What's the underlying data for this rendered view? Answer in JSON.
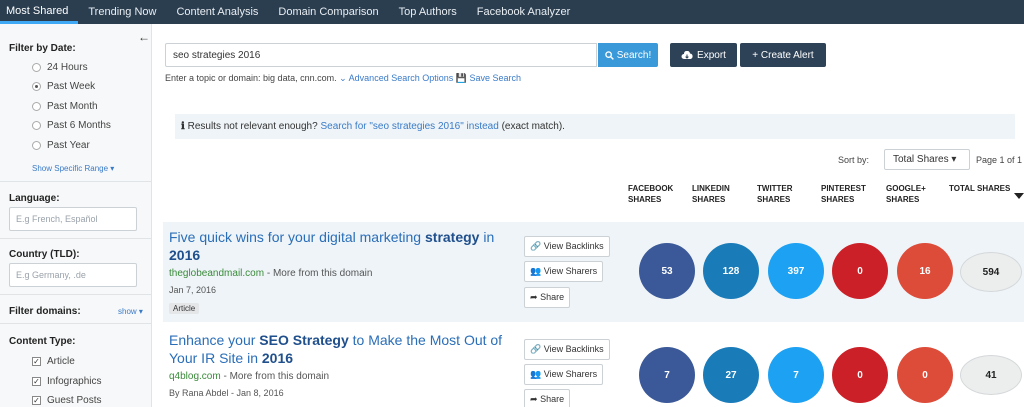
{
  "nav": {
    "tabs": [
      "Most Shared",
      "Trending Now",
      "Content Analysis",
      "Domain Comparison",
      "Top Authors",
      "Facebook Analyzer"
    ]
  },
  "sidebar": {
    "collapse_icon": "arrow-left-icon",
    "filter_date_title": "Filter by Date:",
    "date_options": [
      "24 Hours",
      "Past Week",
      "Past Month",
      "Past 6 Months",
      "Past Year"
    ],
    "date_selected": "Past Week",
    "show_specific_range": "Show Specific Range",
    "language_title": "Language:",
    "language_placeholder": "E.g French, Español",
    "country_title": "Country (TLD):",
    "country_placeholder": "E.g Germany, .de",
    "filter_domains_title": "Filter domains:",
    "filter_domains_show": "show",
    "content_type_title": "Content Type:",
    "content_types": [
      "Article",
      "Infographics",
      "Guest Posts"
    ]
  },
  "search": {
    "value": "seo strategies 2016",
    "button": "Search!",
    "export": "Export",
    "create_alert": "+ Create Alert",
    "hint": "Enter a topic or domain: big data, cnn.com.",
    "advanced": "Advanced Search Options",
    "save": "Save Search"
  },
  "notice": {
    "prefix": "Results not relevant enough?",
    "link": "Search for \"seo strategies 2016\" instead",
    "suffix": "(exact match)."
  },
  "sort": {
    "label": "Sort by:",
    "selected": "Total Shares",
    "page": "Page 1 of 1"
  },
  "columns": [
    {
      "line1": "FACEBOOK",
      "line2": "SHARES"
    },
    {
      "line1": "LINKEDIN",
      "line2": "SHARES"
    },
    {
      "line1": "TWITTER",
      "line2": "SHARES"
    },
    {
      "line1": "PINTEREST",
      "line2": "SHARES"
    },
    {
      "line1": "GOOGLE+",
      "line2": "SHARES"
    },
    {
      "line1": "TOTAL SHARES",
      "line2": ""
    }
  ],
  "colors": {
    "facebook": "#3b5998",
    "linkedin": "#1a7bb9",
    "twitter": "#1da1f2",
    "pinterest": "#cb2027",
    "google": "#dd4b39"
  },
  "actions": {
    "backlinks": "View Backlinks",
    "sharers": "View Sharers",
    "share": "Share"
  },
  "results": [
    {
      "title_a": "Five quick wins for your digital marketing ",
      "title_b": "strategy",
      "title_c": " in ",
      "title_d": "2016",
      "domain": "theglobeandmail.com",
      "more": " - More from this domain",
      "date": "Jan 7, 2016",
      "tag": "Article",
      "facebook": "53",
      "linkedin": "128",
      "twitter": "397",
      "pinterest": "0",
      "google": "16",
      "total": "594"
    },
    {
      "title_a": "Enhance your ",
      "title_b": "SEO Strategy",
      "title_c": " to Make the Most Out of Your IR Site in ",
      "title_d": "2016",
      "domain": "q4blog.com",
      "more": " - More from this domain",
      "date": "By Rana Abdel - Jan 8, 2016",
      "facebook": "7",
      "linkedin": "27",
      "twitter": "7",
      "pinterest": "0",
      "google": "0",
      "total": "41"
    }
  ]
}
